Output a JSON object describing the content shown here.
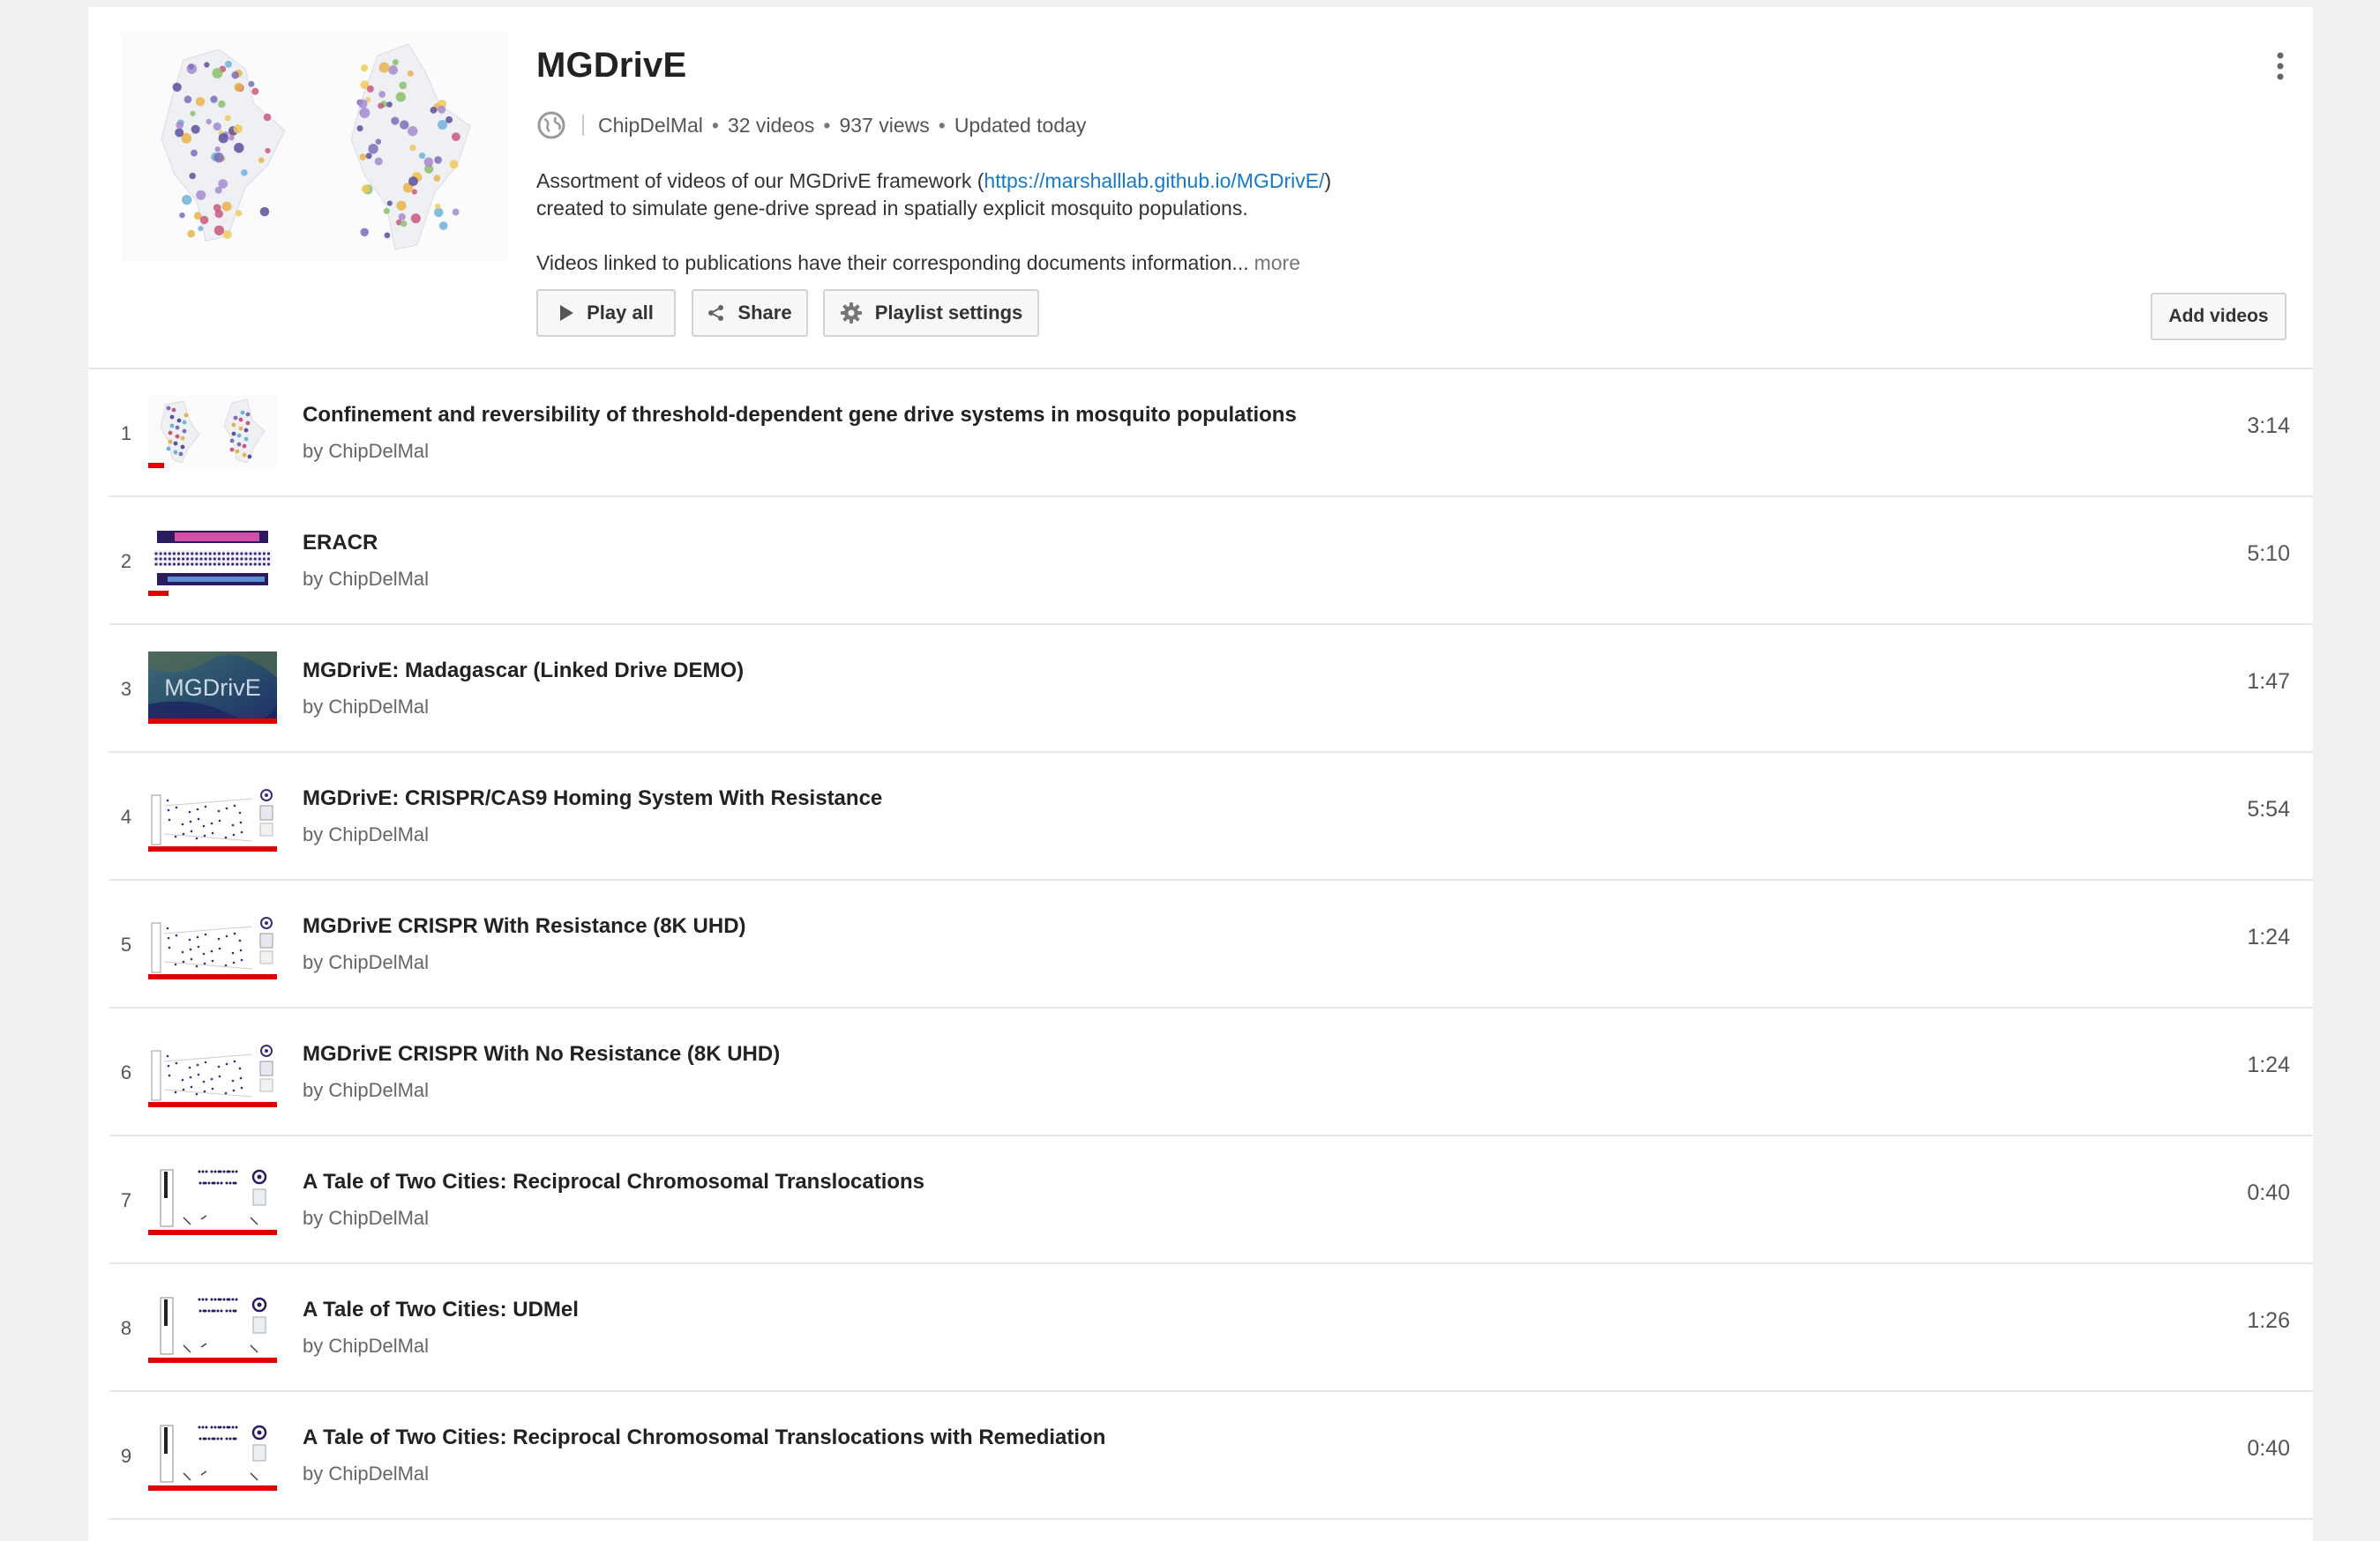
{
  "playlist": {
    "title": "MGDrivE",
    "channel": "ChipDelMal",
    "video_count": "32 videos",
    "views": "937 views",
    "updated": "Updated today",
    "privacy_icon": "globe-icon",
    "desc_line1_prefix": "Assortment of videos of our MGDrivE framework (",
    "desc_link": "https://marshalllab.github.io/MGDrivE/",
    "desc_line1_suffix": ")",
    "desc_line2": "created to simulate gene-drive spread in spatially explicit mosquito populations.",
    "desc_line3": "Videos linked to publications have their corresponding documents information...",
    "more_label": "more"
  },
  "actions": {
    "play_all": "Play all",
    "share": "Share",
    "playlist_settings": "Playlist settings",
    "add_videos": "Add videos"
  },
  "colors": {
    "progress": "#e10000",
    "link": "#167ac6",
    "divider": "#e6e6e6"
  },
  "videos": [
    {
      "index": "1",
      "title": "Confinement and reversibility of threshold-dependent gene drive systems in mosquito populations",
      "by": "by ChipDelMal",
      "duration": "3:14",
      "watched": 0.12,
      "thumb": "maps"
    },
    {
      "index": "2",
      "title": "ERACR",
      "by": "by ChipDelMal",
      "duration": "5:10",
      "watched": 0.16,
      "thumb": "stripes"
    },
    {
      "index": "3",
      "title": "MGDrivE: Madagascar (Linked Drive DEMO)",
      "by": "by ChipDelMal",
      "duration": "1:47",
      "watched": 1.0,
      "thumb": "title-card"
    },
    {
      "index": "4",
      "title": "MGDrivE: CRISPR/CAS9 Homing System With Resistance",
      "by": "by ChipDelMal",
      "duration": "5:54",
      "watched": 1.0,
      "thumb": "scatter"
    },
    {
      "index": "5",
      "title": "MGDrivE CRISPR With Resistance (8K UHD)",
      "by": "by ChipDelMal",
      "duration": "1:24",
      "watched": 1.0,
      "thumb": "scatter"
    },
    {
      "index": "6",
      "title": "MGDrivE CRISPR With No Resistance (8K UHD)",
      "by": "by ChipDelMal",
      "duration": "1:24",
      "watched": 1.0,
      "thumb": "scatter"
    },
    {
      "index": "7",
      "title": "A Tale of Two Cities: Reciprocal Chromosomal Translocations",
      "by": "by ChipDelMal",
      "duration": "0:40",
      "watched": 1.0,
      "thumb": "cities"
    },
    {
      "index": "8",
      "title": "A Tale of Two Cities: UDMel",
      "by": "by ChipDelMal",
      "duration": "1:26",
      "watched": 1.0,
      "thumb": "cities"
    },
    {
      "index": "9",
      "title": "A Tale of Two Cities: Reciprocal Chromosomal Translocations with Remediation",
      "by": "by ChipDelMal",
      "duration": "0:40",
      "watched": 1.0,
      "thumb": "cities"
    }
  ],
  "thumb_text": {
    "title_card": "MGDrivE"
  }
}
